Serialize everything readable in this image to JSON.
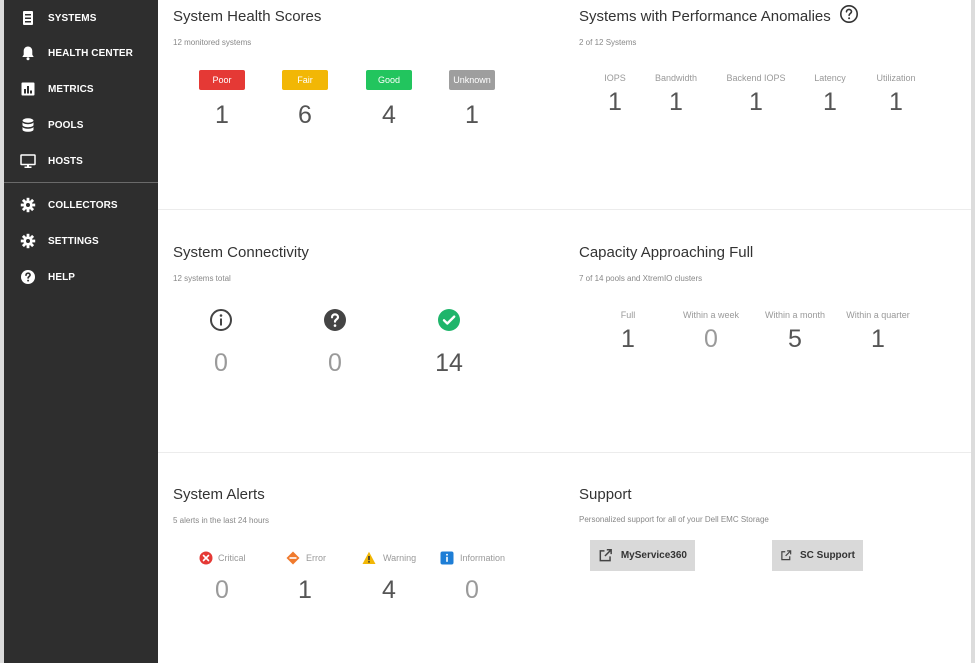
{
  "sidebar": {
    "items": [
      {
        "label": "SYSTEMS",
        "icon": "systems-icon"
      },
      {
        "label": "HEALTH CENTER",
        "icon": "bell-icon"
      },
      {
        "label": "METRICS",
        "icon": "bar-chart-icon"
      },
      {
        "label": "POOLS",
        "icon": "database-icon"
      },
      {
        "label": "HOSTS",
        "icon": "monitor-icon"
      },
      {
        "label": "COLLECTORS",
        "icon": "gear-icon"
      },
      {
        "label": "SETTINGS",
        "icon": "gear-icon"
      },
      {
        "label": "HELP",
        "icon": "help-circle-icon"
      }
    ]
  },
  "health": {
    "title": "System Health Scores",
    "subtitle": "12 monitored systems",
    "badges": [
      {
        "label": "Poor",
        "value": "1",
        "color": "#e53935"
      },
      {
        "label": "Fair",
        "value": "6",
        "color": "#f2b705"
      },
      {
        "label": "Good",
        "value": "4",
        "color": "#22c55e"
      },
      {
        "label": "Unknown",
        "value": "1",
        "color": "#9e9e9e"
      }
    ]
  },
  "anomalies": {
    "title": "Systems with Performance Anomalies",
    "subtitle": "2 of 12 Systems",
    "columns": [
      {
        "label": "IOPS",
        "value": "1"
      },
      {
        "label": "Bandwidth",
        "value": "1"
      },
      {
        "label": "Backend IOPS",
        "value": "1"
      },
      {
        "label": "Latency",
        "value": "1"
      },
      {
        "label": "Utilization",
        "value": "1"
      }
    ]
  },
  "connectivity": {
    "title": "System Connectivity",
    "subtitle": "12 systems total",
    "items": [
      {
        "icon": "info-circle-icon",
        "value": "0"
      },
      {
        "icon": "question-circle-icon",
        "value": "0"
      },
      {
        "icon": "check-circle-icon",
        "value": "14"
      }
    ],
    "check_color": "#1fb56b"
  },
  "capacity": {
    "title": "Capacity Approaching Full",
    "subtitle": "7 of 14 pools and XtremIO clusters",
    "columns": [
      {
        "label": "Full",
        "value": "1"
      },
      {
        "label": "Within a week",
        "value": "0"
      },
      {
        "label": "Within a month",
        "value": "5"
      },
      {
        "label": "Within a quarter",
        "value": "1"
      }
    ]
  },
  "alerts": {
    "title": "System Alerts",
    "subtitle": "5 alerts in the last 24 hours",
    "items": [
      {
        "label": "Critical",
        "value": "0",
        "icon": "critical-icon",
        "color": "#e53935"
      },
      {
        "label": "Error",
        "value": "1",
        "icon": "error-icon",
        "color": "#f07a2d"
      },
      {
        "label": "Warning",
        "value": "4",
        "icon": "warning-icon",
        "color": "#f2b705"
      },
      {
        "label": "Information",
        "value": "0",
        "icon": "information-icon",
        "color": "#1e7ed6"
      }
    ]
  },
  "support": {
    "title": "Support",
    "subtitle": "Personalized support for all of your Dell EMC Storage",
    "buttons": [
      {
        "label": "MyService360"
      },
      {
        "label": "SC Support"
      }
    ]
  }
}
